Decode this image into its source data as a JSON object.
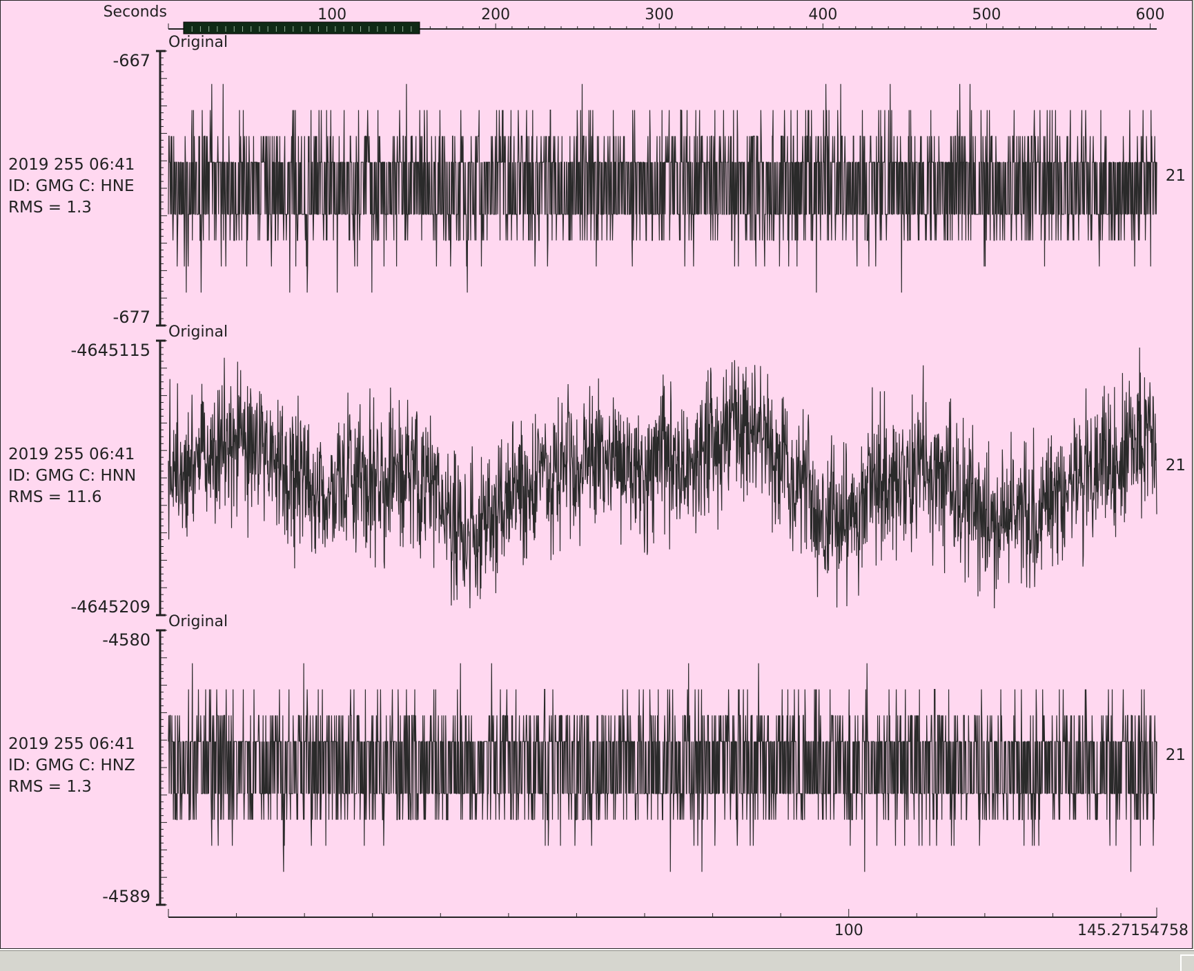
{
  "chart_data": {
    "type": "line",
    "top_axis": {
      "label": "Seconds",
      "ticks": [
        100,
        200,
        300,
        400,
        500,
        600
      ],
      "range": [
        0,
        604
      ]
    },
    "bottom_axis": {
      "ticks": [
        100
      ],
      "end_label": "145.27154758",
      "range": [
        0,
        145.27154758
      ]
    },
    "colors": {
      "background": "#ffd8f0",
      "trace": "#2a2a2a",
      "scroll_thumb": "#0f2a16",
      "frame": "#222222"
    },
    "panels": [
      {
        "tag": "Original",
        "ymax_label": "-667",
        "ymin_label": "-677",
        "ylim": [
          -677,
          -667
        ],
        "info": [
          "2019 255 06:41",
          "ID: GMG C: HNE",
          "RMS = 1.3"
        ],
        "right_label": "21",
        "signal": "quantized",
        "base": -672
      },
      {
        "tag": "Original",
        "ymax_label": "-4645115",
        "ymin_label": "-4645209",
        "ylim": [
          -4645209,
          -4645115
        ],
        "info": [
          "2019 255 06:41",
          "ID: GMG C: HNN",
          "RMS = 11.6"
        ],
        "right_label": "21",
        "signal": "noise",
        "base": -4645162
      },
      {
        "tag": "Original",
        "ymax_label": "-4580",
        "ymin_label": "-4589",
        "ylim": [
          -4589,
          -4580
        ],
        "info": [
          "2019 255 06:41",
          "ID: GMG C: HNZ",
          "RMS = 1.3"
        ],
        "right_label": "21",
        "signal": "quantized",
        "base": -4584.5
      }
    ]
  }
}
